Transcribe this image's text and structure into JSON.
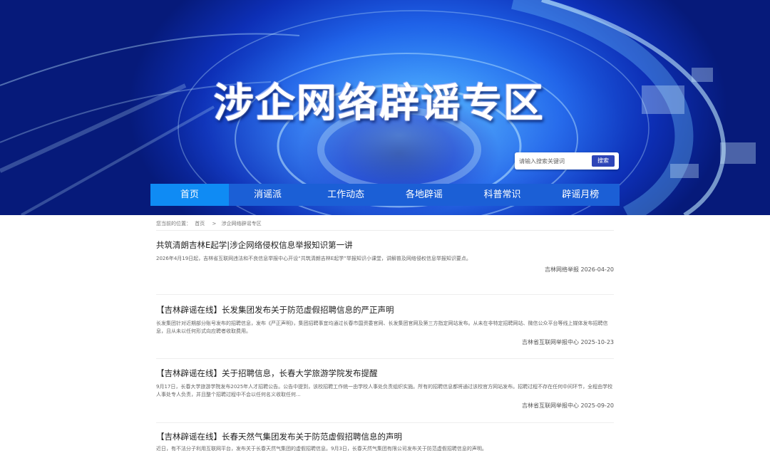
{
  "banner": {
    "title": "涉企网络辟谣专区"
  },
  "search": {
    "placeholder": "请输入搜索关键词",
    "button_label": "搜索"
  },
  "nav": {
    "items": [
      {
        "label": "首页",
        "active": true
      },
      {
        "label": "消谣派",
        "active": false
      },
      {
        "label": "工作动态",
        "active": false
      },
      {
        "label": "各地辟谣",
        "active": false
      },
      {
        "label": "科普常识",
        "active": false
      },
      {
        "label": "辟谣月榜",
        "active": false
      }
    ]
  },
  "breadcrumb": {
    "prefix": "您当前的位置：",
    "home": "首页",
    "separator": ">",
    "current": "涉企网络辟谣专区"
  },
  "articles": [
    {
      "title": "共筑清朗吉林E起学|涉企网络侵权信息举报知识第一讲",
      "summary": "2026年4月19日起，吉林省互联网违法和不良信息举报中心开设“共筑清朗吉林E起学”举报知识小课堂，讲解普及网络侵权信息举报知识要点。",
      "source": "吉林网络举报",
      "date": "2026-04-20"
    },
    {
      "title": "【吉林辟谣在线】长发集团发布关于防范虚假招聘信息的严正声明",
      "summary": "长发集团针对近期部分账号发布的招聘信息，发布《严正声明》，集团招聘事宜均通过长春市国资委官网、长发集团官网及第三方指定网站发布。从未在非特定招聘网站、微信公众平台等线上媒体发布招聘信息，且从未以任何形式向应聘者收取费用。",
      "source": "吉林省互联网举报中心",
      "date": "2025-10-23"
    },
    {
      "title": "【吉林辟谣在线】关于招聘信息，长春大学旅游学院发布提醒",
      "summary": "9月17日，长春大学旅游学院发布2025年人才招聘公告。公告中提到，该校招聘工作统一由学校人事处负责组织实施。所有的招聘信息都将通过该校官方网站发布。招聘过程不存在任何中间环节，全程由学校人事处专人负责，并且整个招聘过程中不会以任何名义收取任何...",
      "source": "吉林省互联网举报中心",
      "date": "2025-09-20"
    },
    {
      "title": "【吉林辟谣在线】长春天然气集团发布关于防范虚假招聘信息的声明",
      "summary": "近日，有不法分子利用互联网平台，发布关于长春天然气集团的虚假招聘信息。9月3日，长春天然气集团有限公司发布关于防范虚假招聘信息的声明。",
      "source": "",
      "date": ""
    }
  ]
}
